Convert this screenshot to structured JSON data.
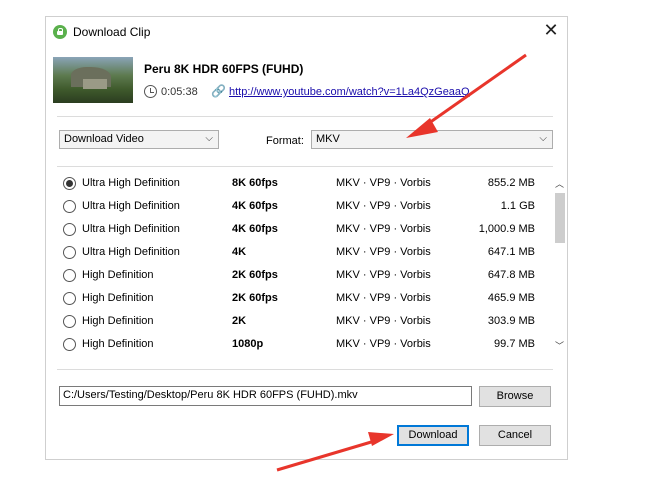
{
  "window": {
    "title": "Download Clip",
    "close_label": "✕"
  },
  "clip": {
    "title": "Peru 8K HDR 60FPS (FUHD)",
    "duration": "0:05:38",
    "url": "http://www.youtube.com/watch?v=1La4QzGeaaQ"
  },
  "download_type": {
    "selected": "Download Video"
  },
  "format": {
    "label": "Format:",
    "selected": "MKV"
  },
  "options": [
    {
      "definition": "Ultra High Definition",
      "resolution": "8K 60fps",
      "codec": "MKV · VP9 · Vorbis",
      "size": "855.2 MB",
      "checked": true
    },
    {
      "definition": "Ultra High Definition",
      "resolution": "4K 60fps",
      "codec": "MKV · VP9 · Vorbis",
      "size": "1.1 GB",
      "checked": false
    },
    {
      "definition": "Ultra High Definition",
      "resolution": "4K 60fps",
      "codec": "MKV · VP9 · Vorbis",
      "size": "1,000.9 MB",
      "checked": false
    },
    {
      "definition": "Ultra High Definition",
      "resolution": "4K",
      "codec": "MKV · VP9 · Vorbis",
      "size": "647.1 MB",
      "checked": false
    },
    {
      "definition": "High Definition",
      "resolution": "2K 60fps",
      "codec": "MKV · VP9 · Vorbis",
      "size": "647.8 MB",
      "checked": false
    },
    {
      "definition": "High Definition",
      "resolution": "2K 60fps",
      "codec": "MKV · VP9 · Vorbis",
      "size": "465.9 MB",
      "checked": false
    },
    {
      "definition": "High Definition",
      "resolution": "2K",
      "codec": "MKV · VP9 · Vorbis",
      "size": "303.9 MB",
      "checked": false
    },
    {
      "definition": "High Definition",
      "resolution": "1080p",
      "codec": "MKV · VP9 · Vorbis",
      "size": "99.7 MB",
      "checked": false
    }
  ],
  "save_path": "C:/Users/Testing/Desktop/Peru 8K HDR 60FPS (FUHD).mkv",
  "buttons": {
    "browse": "Browse",
    "download": "Download",
    "cancel": "Cancel"
  },
  "colors": {
    "annotation_arrow": "#e8352b",
    "primary_border": "#0078d7"
  }
}
